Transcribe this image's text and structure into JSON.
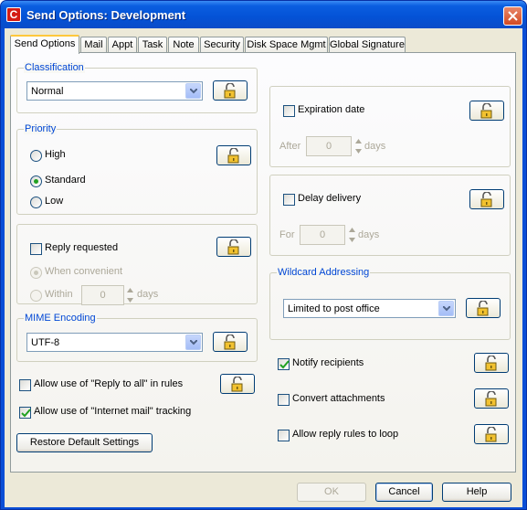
{
  "window": {
    "title": "Send Options:  Development",
    "app_icon_letter": "C"
  },
  "tabs": [
    {
      "label": "Send Options",
      "active": true
    },
    {
      "label": "Mail"
    },
    {
      "label": "Appt"
    },
    {
      "label": "Task"
    },
    {
      "label": "Note"
    },
    {
      "label": "Security"
    },
    {
      "label": "Disk Space Mgmt"
    },
    {
      "label": "Global Signature"
    }
  ],
  "classification": {
    "label": "Classification",
    "value": "Normal"
  },
  "priority": {
    "label": "Priority",
    "options": [
      {
        "label": "High",
        "checked": false
      },
      {
        "label": "Standard",
        "checked": true
      },
      {
        "label": "Low",
        "checked": false
      }
    ]
  },
  "reply": {
    "label": "Reply requested",
    "checked": false,
    "when_convenient": "When convenient",
    "within": "Within",
    "within_value": "0",
    "days": "days"
  },
  "mime": {
    "label": "MIME Encoding",
    "value": "UTF-8"
  },
  "left_checks": [
    {
      "label": "Allow use of  \"Reply to all\" in rules",
      "checked": false
    },
    {
      "label": "Allow use of  \"Internet mail\" tracking",
      "checked": true
    }
  ],
  "restore_label": "Restore Default Settings",
  "expiration": {
    "label": "Expiration date",
    "checked": false,
    "after": "After",
    "value": "0",
    "days": "days"
  },
  "delay": {
    "label": "Delay delivery",
    "checked": false,
    "for": "For",
    "value": "0",
    "days": "days"
  },
  "wildcard": {
    "label": "Wildcard Addressing",
    "value": "Limited to post office"
  },
  "right_checks": [
    {
      "label": "Notify recipients",
      "checked": true
    },
    {
      "label": "Convert attachments",
      "checked": false
    },
    {
      "label": "Allow reply rules to loop",
      "checked": false
    }
  ],
  "buttons": {
    "ok": "OK",
    "cancel": "Cancel",
    "help": "Help"
  },
  "colors": {
    "title_bar": "#0452d6",
    "group_label": "#0046d5",
    "check_green": "#21a121"
  }
}
